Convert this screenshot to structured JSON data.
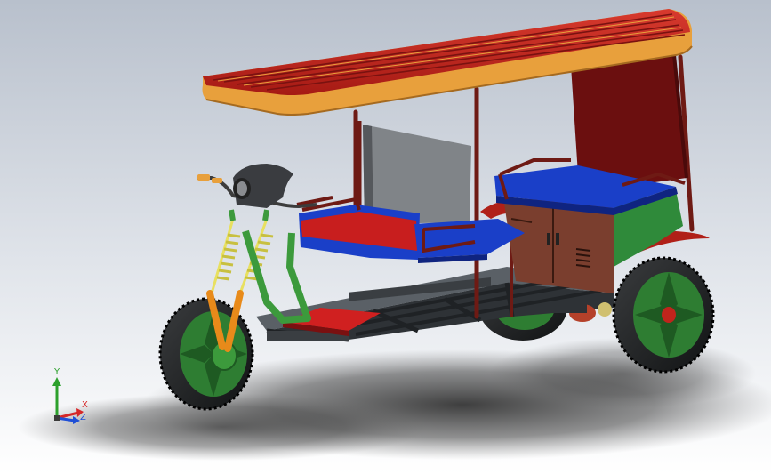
{
  "viewport": {
    "background_top": "#b8c0cc",
    "background_bottom": "#ffffff"
  },
  "colors": {
    "canopy_slats": "#c0241c",
    "canopy_trim": "#e8a03c",
    "frame_tube": "#6e1a14",
    "backrest_panel": "#6b0f0f",
    "front_seat": "#c81e1e",
    "rear_seat": "#1a3fc8",
    "cargo_box": "#7a3e2e",
    "side_panel_green": "#2f8a3a",
    "rear_fender": "#b02018",
    "chassis_grey": "#5a6066",
    "chassis_dark": "#2e3236",
    "tyre": "#1c1e20",
    "rim_green": "#2e7d32",
    "fork_orange": "#e88a1a",
    "fork_green": "#3c9a3c",
    "spring_yellow": "#e8e060",
    "seat_frame_grey": "#808488",
    "headlamp": "#3a3c40",
    "footboard_red": "#d02020"
  },
  "triad": {
    "y_label": "Y",
    "x_label": "X",
    "z_label": "Z",
    "y_color": "#2ca02c",
    "x_color": "#d62728",
    "z_color": "#1f4fd6"
  }
}
